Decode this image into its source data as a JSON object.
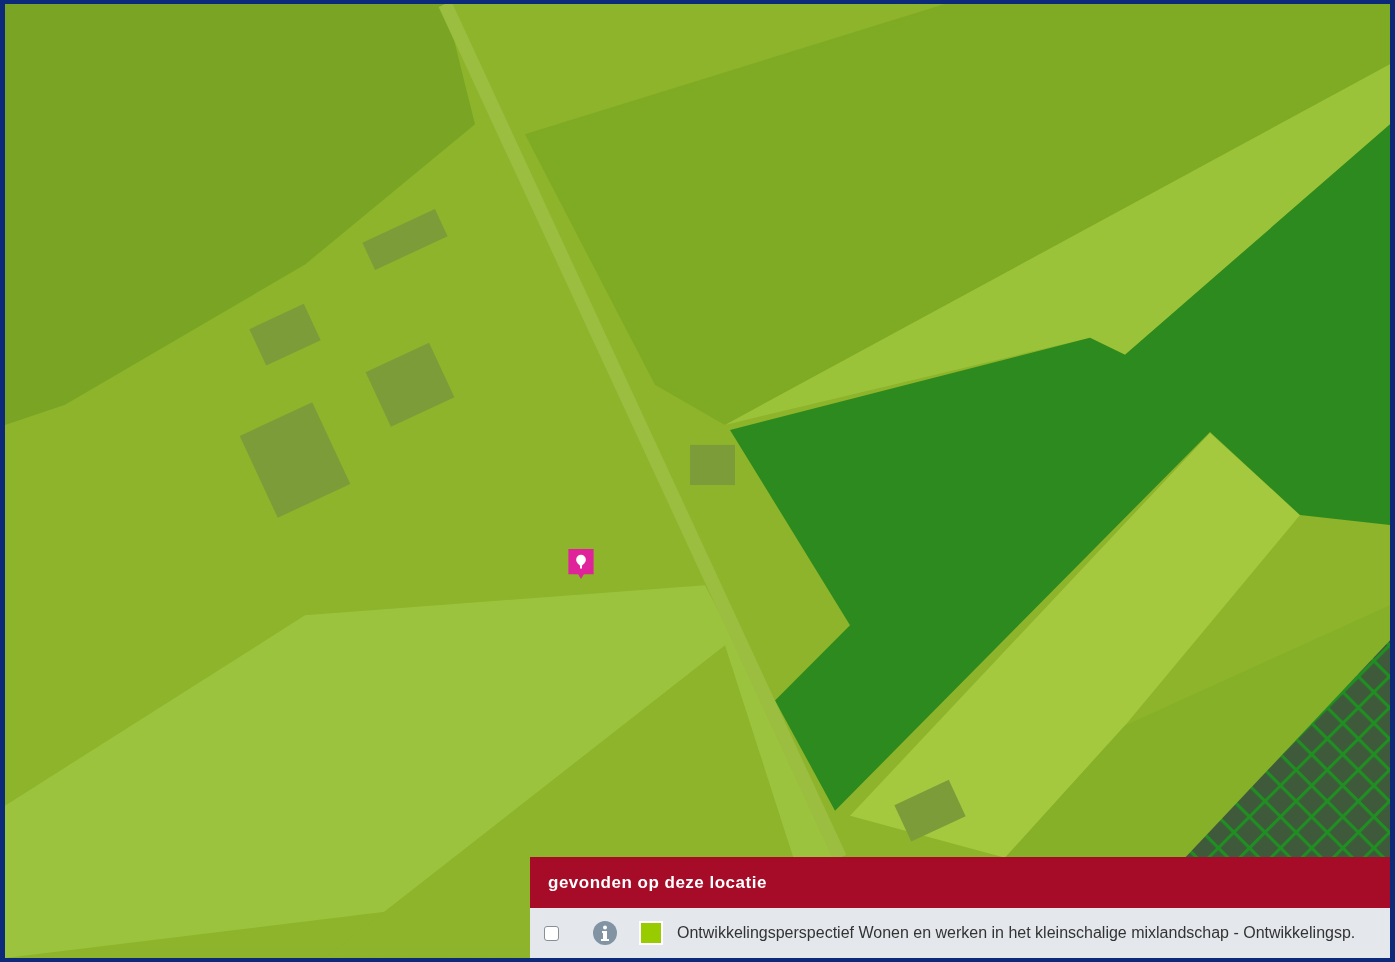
{
  "map": {
    "marker": {
      "kind": "pin"
    }
  },
  "results_panel": {
    "title": "gevonden op deze locatie",
    "items": [
      {
        "checked": false,
        "color": "#99cc00",
        "label": "Ontwikkelingsperspectief Wonen en werken in het kleinschalige mixlandschap - Ontwikkelingsp."
      }
    ]
  }
}
